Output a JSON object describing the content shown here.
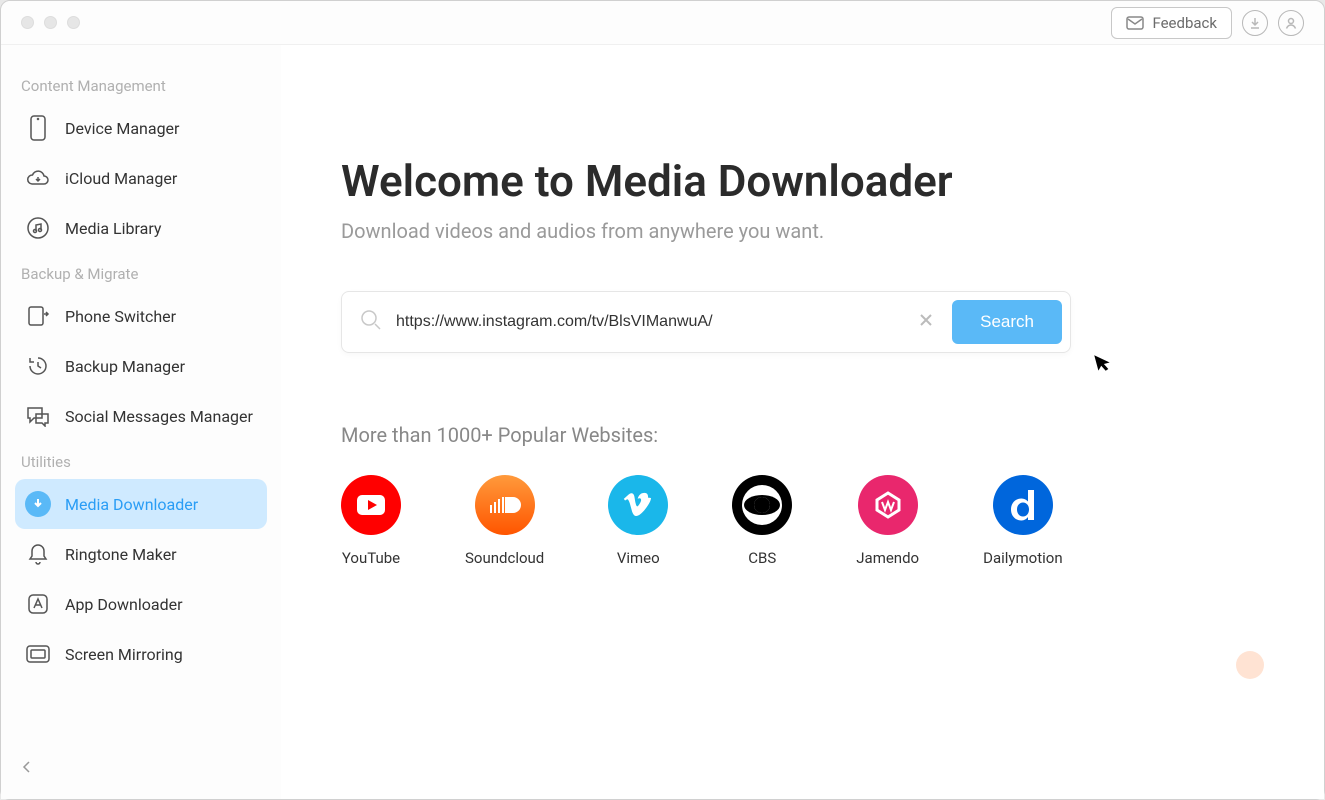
{
  "header": {
    "feedback_label": "Feedback"
  },
  "sidebar": {
    "sections": [
      {
        "label": "Content Management",
        "items": [
          {
            "label": "Device Manager",
            "icon": "device-icon"
          },
          {
            "label": "iCloud Manager",
            "icon": "cloud-icon"
          },
          {
            "label": "Media Library",
            "icon": "music-icon"
          }
        ]
      },
      {
        "label": "Backup & Migrate",
        "items": [
          {
            "label": "Phone Switcher",
            "icon": "switch-icon"
          },
          {
            "label": "Backup Manager",
            "icon": "history-icon"
          },
          {
            "label": "Social Messages Manager",
            "icon": "chat-icon"
          }
        ]
      },
      {
        "label": "Utilities",
        "items": [
          {
            "label": "Media Downloader",
            "icon": "download-icon",
            "active": true
          },
          {
            "label": "Ringtone Maker",
            "icon": "bell-icon"
          },
          {
            "label": "App Downloader",
            "icon": "app-icon"
          },
          {
            "label": "Screen Mirroring",
            "icon": "mirror-icon"
          }
        ]
      }
    ]
  },
  "main": {
    "title": "Welcome to Media Downloader",
    "subtitle": "Download videos and audios from anywhere you want.",
    "search_value": "https://www.instagram.com/tv/BlsVIManwuA/",
    "search_button": "Search",
    "sites_label": "More than 1000+ Popular Websites:",
    "sites": [
      {
        "label": "YouTube",
        "bg": "#ff0000"
      },
      {
        "label": "Soundcloud",
        "bg": "#ff7700"
      },
      {
        "label": "Vimeo",
        "bg": "#1ab7ea"
      },
      {
        "label": "CBS",
        "bg": "#000000"
      },
      {
        "label": "Jamendo",
        "bg": "#e9276d"
      },
      {
        "label": "Dailymotion",
        "bg": "#0066dc"
      }
    ]
  }
}
